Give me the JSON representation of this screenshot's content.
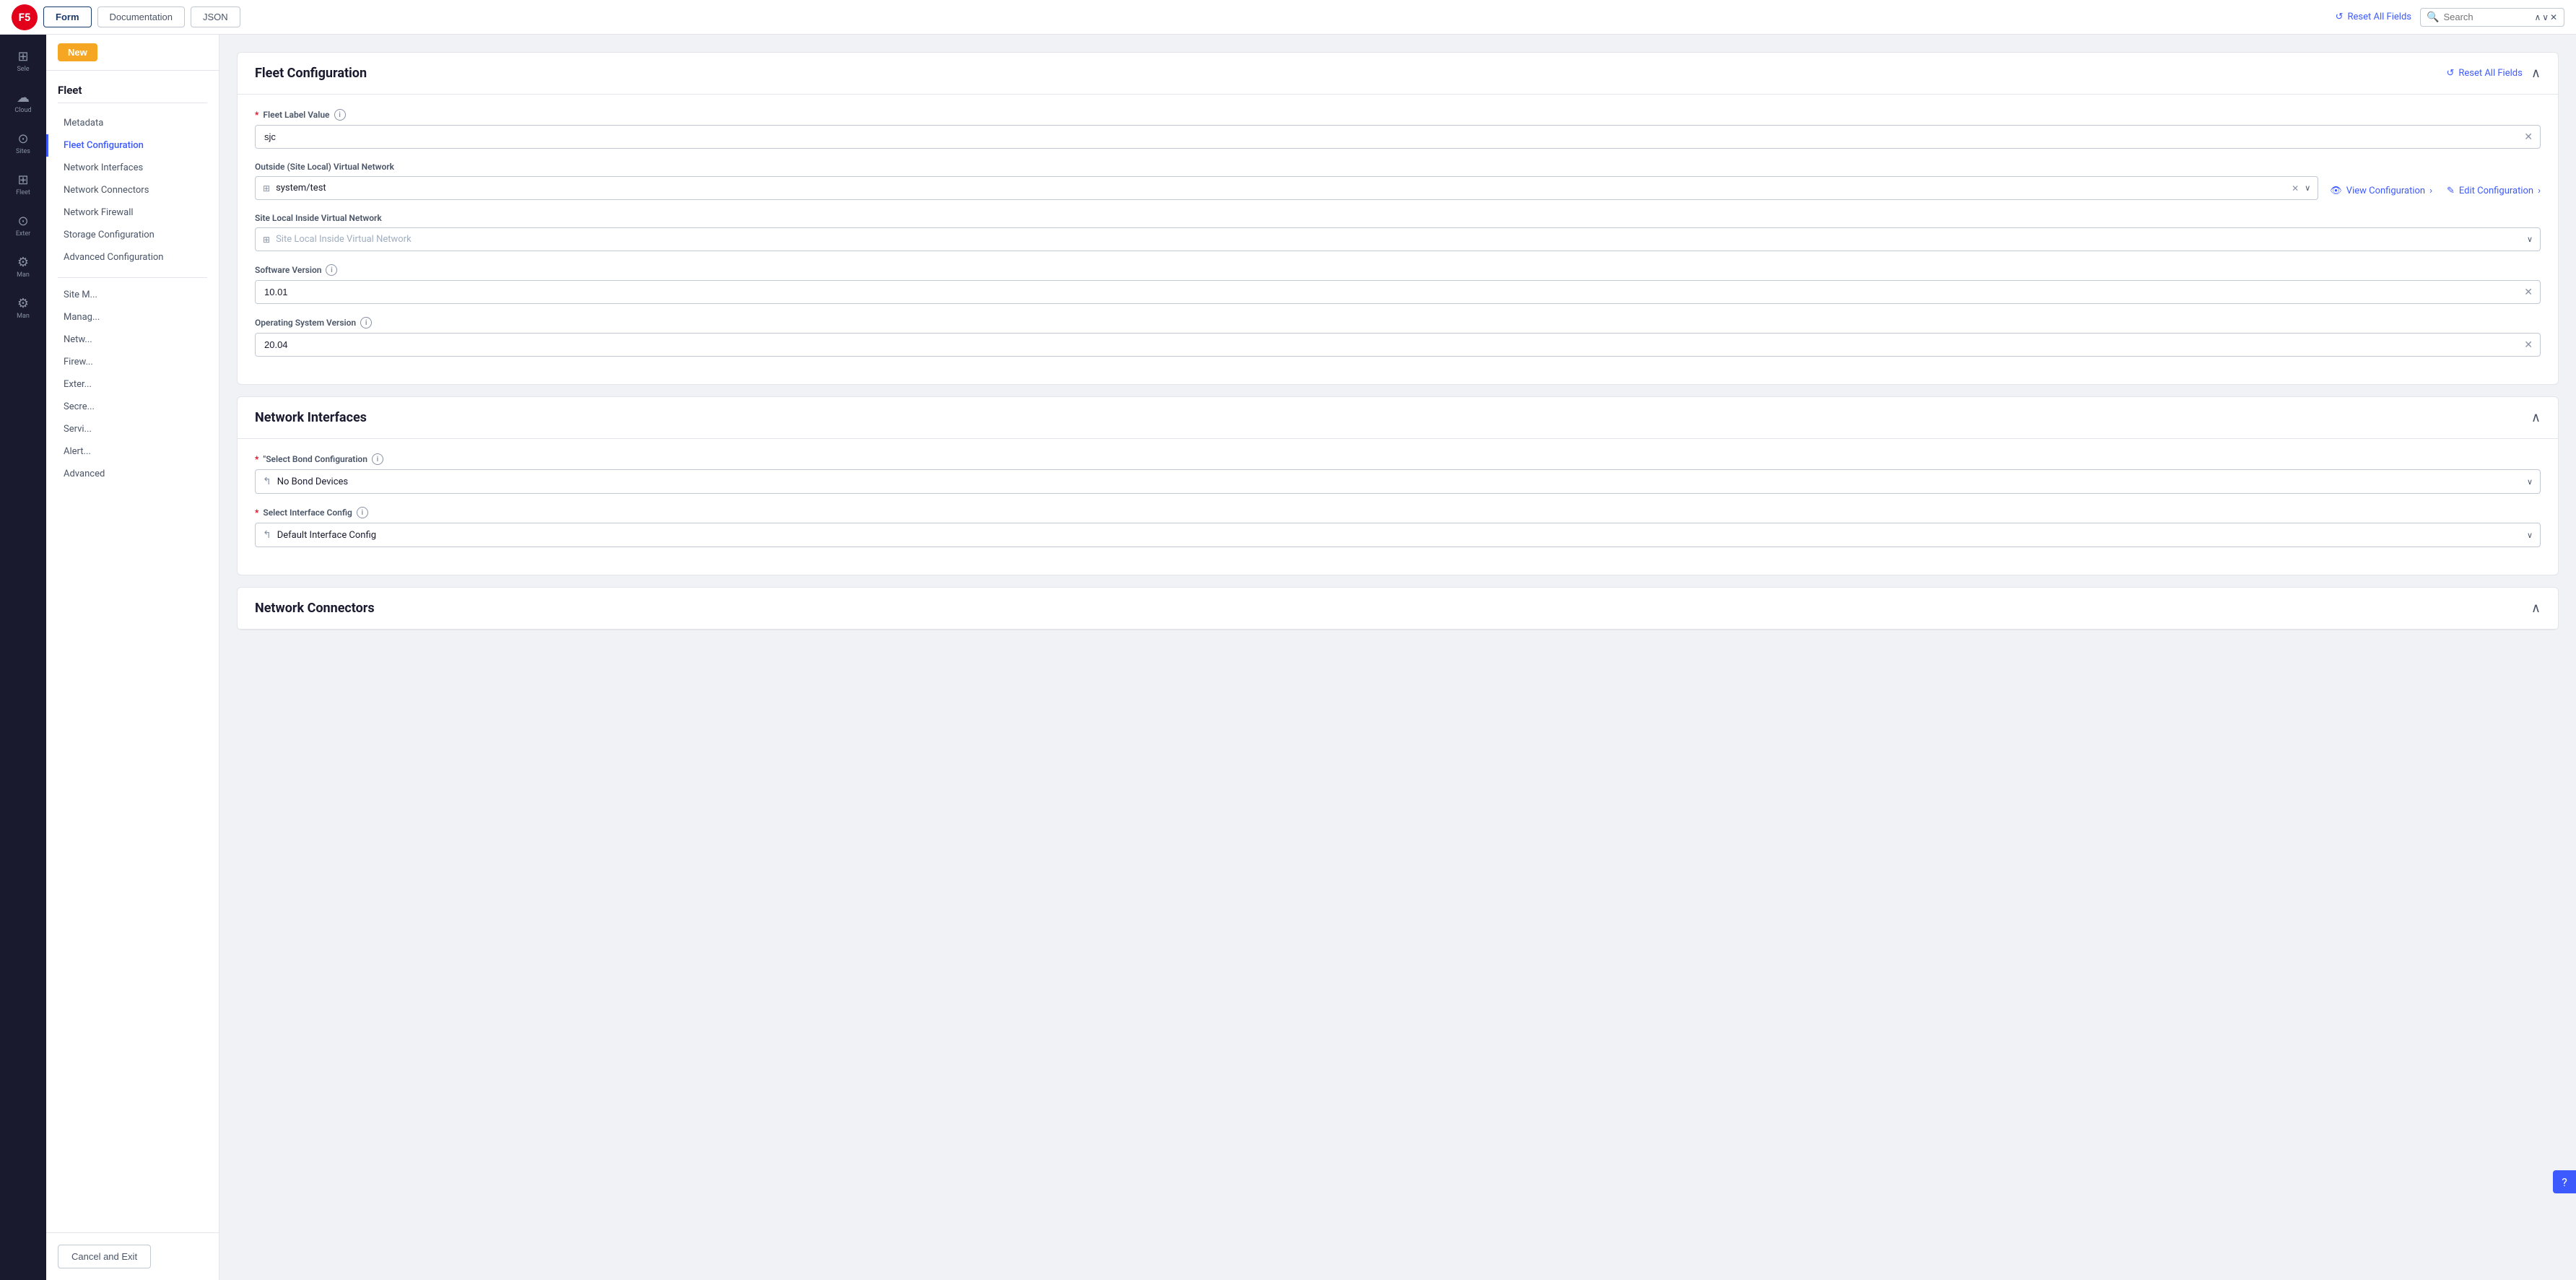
{
  "topbar": {
    "logo_text": "F5",
    "tabs": [
      {
        "id": "form",
        "label": "Form",
        "active": true
      },
      {
        "id": "documentation",
        "label": "Documentation",
        "active": false
      },
      {
        "id": "json",
        "label": "JSON",
        "active": false
      }
    ],
    "reset_label": "Reset All Fields",
    "search_placeholder": "Search"
  },
  "left_panel": {
    "items": [
      {
        "id": "grid",
        "icon": "⊞",
        "label": "Sele"
      },
      {
        "id": "cloud",
        "icon": "☁",
        "label": "Cloud"
      },
      {
        "id": "sites",
        "icon": "⊙",
        "label": "Sites"
      },
      {
        "id": "fleet",
        "icon": "⊞",
        "label": "Fleet"
      },
      {
        "id": "extern",
        "icon": "⊙",
        "label": "Exter"
      },
      {
        "id": "manage",
        "icon": "⚙",
        "label": "Man"
      },
      {
        "id": "manage2",
        "icon": "⚙",
        "label": "Man"
      }
    ]
  },
  "sidebar": {
    "new_button": "New",
    "title": "Fleet",
    "items": [
      {
        "id": "metadata",
        "label": "Metadata",
        "active": false
      },
      {
        "id": "fleet-configuration",
        "label": "Fleet Configuration",
        "active": true
      },
      {
        "id": "network-interfaces",
        "label": "Network Interfaces",
        "active": false
      },
      {
        "id": "network-connectors",
        "label": "Network Connectors",
        "active": false
      },
      {
        "id": "network-firewall",
        "label": "Network Firewall",
        "active": false
      },
      {
        "id": "storage-configuration",
        "label": "Storage Configuration",
        "active": false
      },
      {
        "id": "advanced-configuration",
        "label": "Advanced Configuration",
        "active": false
      }
    ],
    "sub_items": [
      "Site M",
      "Manag",
      "Netw",
      "Firew",
      "Exter",
      "Secre",
      "Servi",
      "Alert",
      "Advanced"
    ],
    "cancel_button": "Cancel and Exit"
  },
  "fleet_configuration": {
    "title": "Fleet Configuration",
    "reset_label": "Reset All Fields",
    "fields": {
      "fleet_label_value": {
        "label": "Fleet Label Value",
        "required": true,
        "info": true,
        "value": "sjc"
      },
      "outside_virtual_network": {
        "label": "Outside (Site Local) Virtual Network",
        "required": false,
        "info": false,
        "value": "system/test",
        "icon": "⊞",
        "actions": {
          "view": "View Configuration",
          "edit": "Edit Configuration"
        }
      },
      "site_local_inside_virtual_network": {
        "label": "Site Local Inside Virtual Network",
        "required": false,
        "info": false,
        "placeholder": "Site Local Inside Virtual Network",
        "icon": "⊞"
      },
      "software_version": {
        "label": "Software Version",
        "required": false,
        "info": true,
        "value": "10.01"
      },
      "operating_system_version": {
        "label": "Operating System Version",
        "required": false,
        "info": true,
        "value": "20.04"
      }
    }
  },
  "network_interfaces": {
    "title": "Network Interfaces",
    "fields": {
      "bond_configuration": {
        "label": "\"Select Bond Configuration",
        "required": true,
        "info": true,
        "value": "No Bond Devices",
        "icon": "↰"
      },
      "interface_config": {
        "label": "Select Interface Config",
        "required": true,
        "info": true,
        "value": "Default Interface Config",
        "icon": "↰"
      }
    }
  },
  "network_connectors": {
    "title": "Network Connectors"
  },
  "icons": {
    "reset": "↺",
    "search": "🔍",
    "chevron_up": "∧",
    "chevron_down": "∨",
    "close": "✕",
    "view": "👁",
    "edit": "✎",
    "chevron_right": ">",
    "help": "?"
  }
}
